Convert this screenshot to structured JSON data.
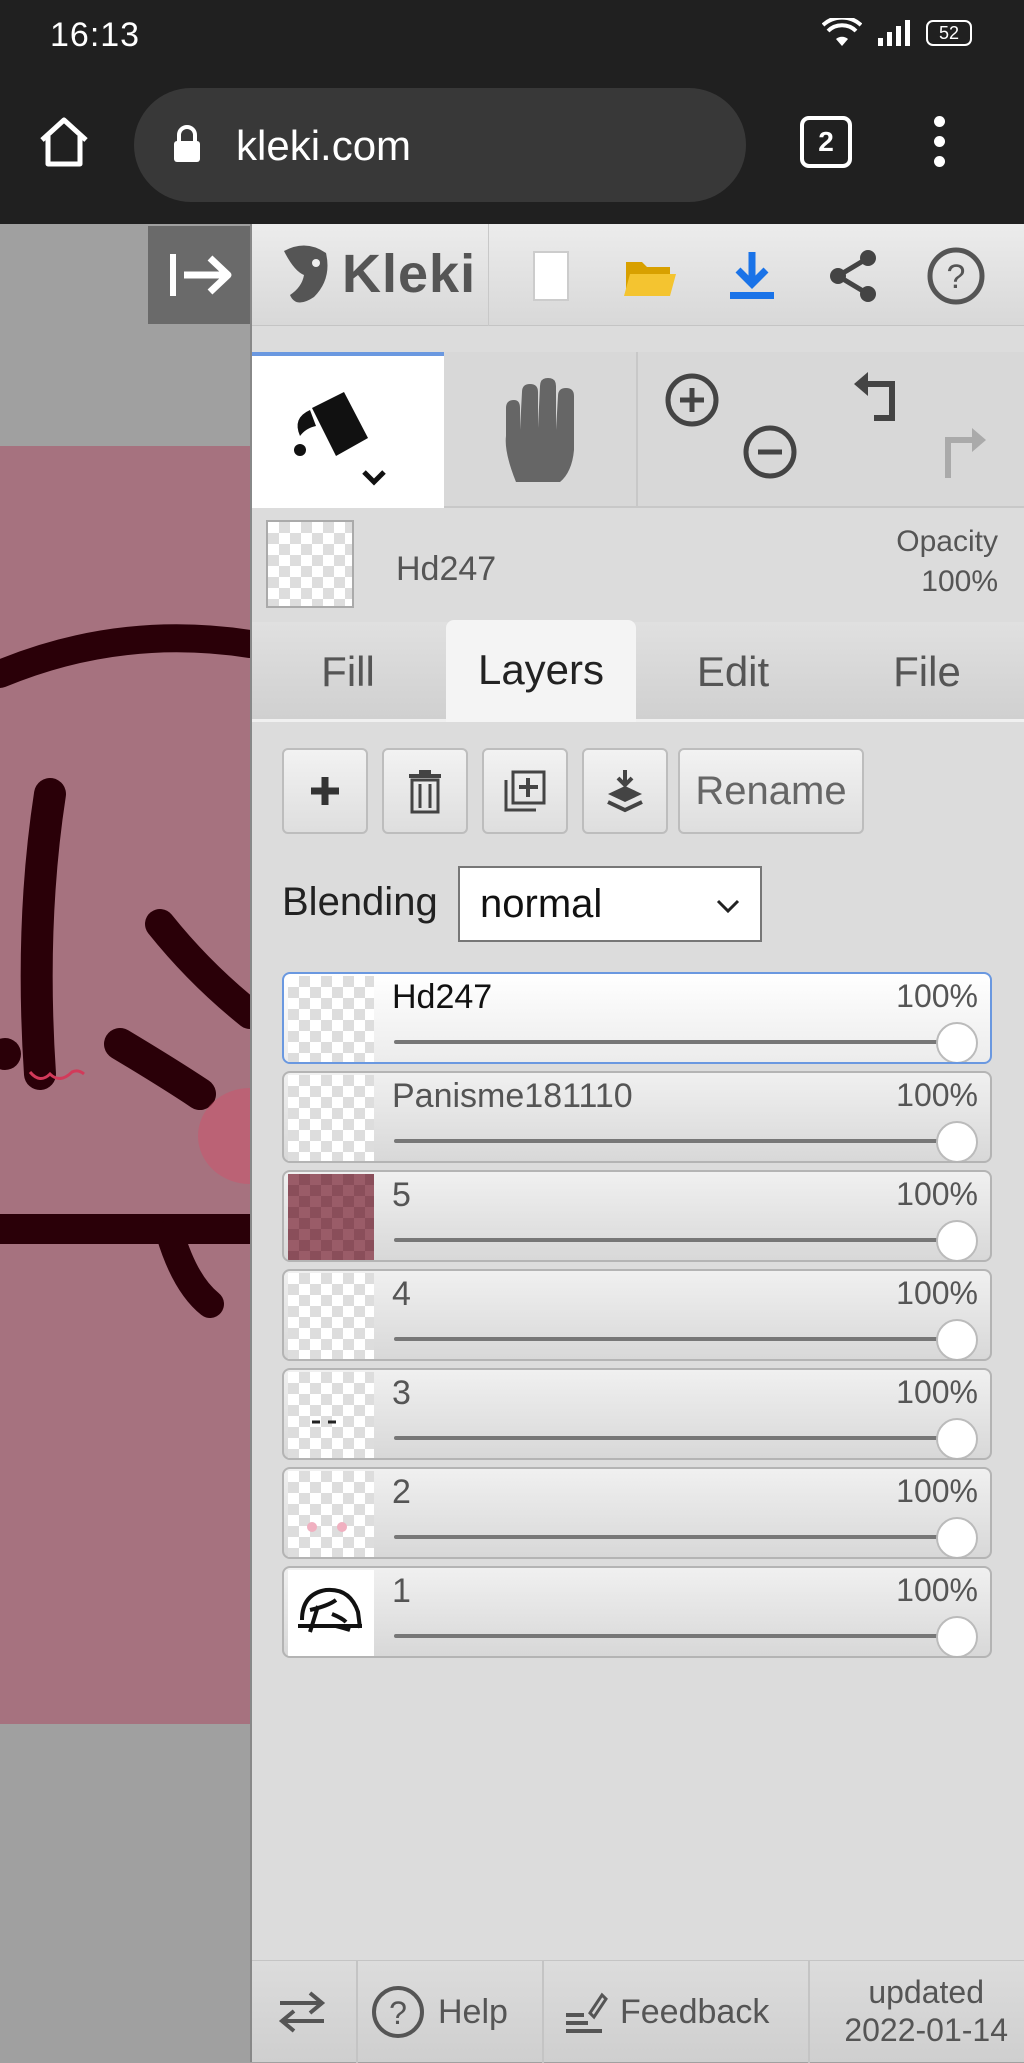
{
  "status": {
    "time": "16:13",
    "battery": "52"
  },
  "browser": {
    "url": "kleki.com",
    "tab_count": "2"
  },
  "app": {
    "logo": "Kleki",
    "current_layer": "Hd247",
    "opacity_label": "Opacity",
    "opacity_value": "100%",
    "tabs": [
      "Fill",
      "Layers",
      "Edit",
      "File"
    ],
    "active_tab": "Layers",
    "rename_label": "Rename",
    "blending_label": "Blending",
    "blending_value": "normal",
    "layers": [
      {
        "name": "Hd247",
        "opacity": "100%"
      },
      {
        "name": "Panisme181110",
        "opacity": "100%"
      },
      {
        "name": "5",
        "opacity": "100%"
      },
      {
        "name": "4",
        "opacity": "100%"
      },
      {
        "name": "3",
        "opacity": "100%"
      },
      {
        "name": "2",
        "opacity": "100%"
      },
      {
        "name": "1",
        "opacity": "100%"
      }
    ],
    "bottom": {
      "help": "Help",
      "feedback": "Feedback",
      "updated_label": "updated",
      "updated_date": "2022-01-14"
    }
  },
  "colors": {
    "accent": "#6a98e0",
    "download": "#1a73e8",
    "folder": "#f4b400",
    "canvas_pink": "#a6727f",
    "ink": "#2a0008"
  }
}
